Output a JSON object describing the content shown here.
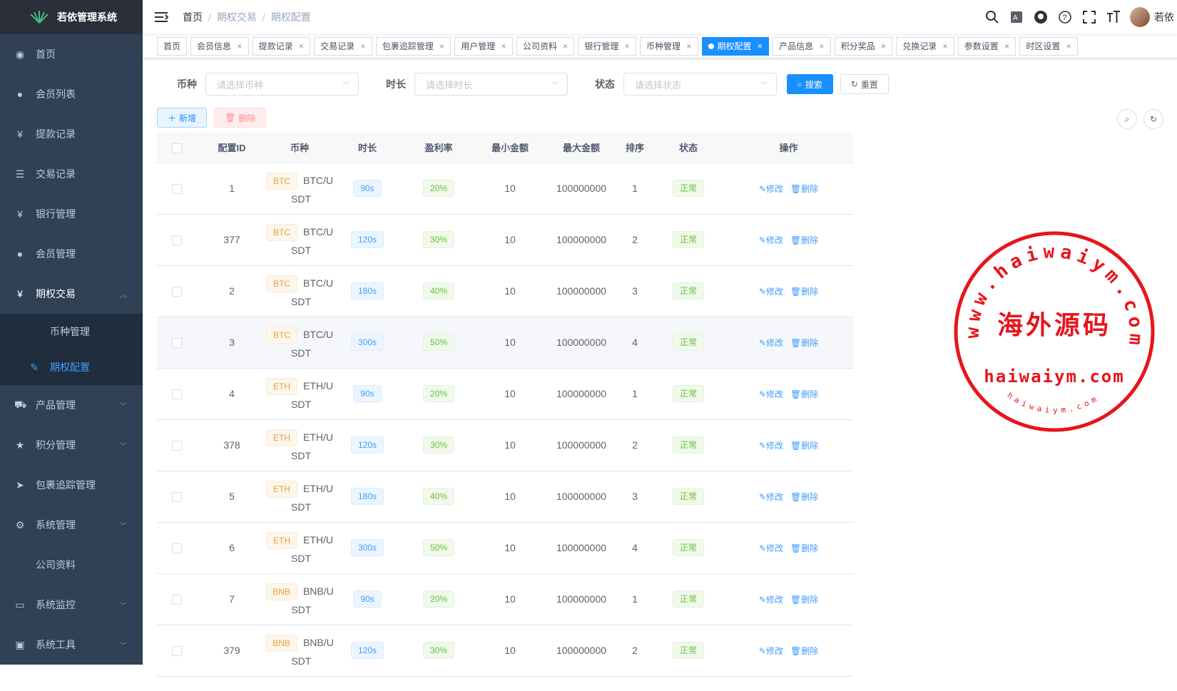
{
  "app": {
    "title": "若依管理系统"
  },
  "sidebar": {
    "items": [
      {
        "label": "首页",
        "icon": "dashboard-icon"
      },
      {
        "label": "会员列表",
        "icon": "user-icon"
      },
      {
        "label": "提款记录",
        "icon": "yen-icon"
      },
      {
        "label": "交易记录",
        "icon": "list-icon"
      },
      {
        "label": "银行管理",
        "icon": "yen-icon"
      },
      {
        "label": "会员管理",
        "icon": "peoples-icon"
      },
      {
        "label": "期权交易",
        "icon": "yen-icon"
      },
      {
        "label": "币种管理"
      },
      {
        "label": "期权配置",
        "icon": "edit-icon"
      },
      {
        "label": "产品管理",
        "icon": "cart-icon"
      },
      {
        "label": "积分管理",
        "icon": "star-icon"
      },
      {
        "label": "包裹追踪管理",
        "icon": "send-icon"
      },
      {
        "label": "系统管理",
        "icon": "gear-icon"
      },
      {
        "label": "公司资料"
      },
      {
        "label": "系统监控",
        "icon": "monitor-icon"
      },
      {
        "label": "系统工具",
        "icon": "tool-icon"
      }
    ]
  },
  "breadcrumb": [
    "首页",
    "期权交易",
    "期权配置"
  ],
  "header": {
    "user": "若依"
  },
  "tags": [
    "首页",
    "会员信息",
    "提款记录",
    "交易记录",
    "包裹追踪管理",
    "用户管理",
    "公司资料",
    "银行管理",
    "币种管理",
    "期权配置",
    "产品信息",
    "积分奖品",
    "兑换记录",
    "参数设置",
    "时区设置"
  ],
  "search": {
    "coin_label": "币种",
    "coin_placeholder": "请选择币种",
    "duration_label": "时长",
    "duration_placeholder": "请选择时长",
    "status_label": "状态",
    "status_placeholder": "请选择状态",
    "search_btn": "搜索",
    "reset_btn": "重置"
  },
  "toolbar": {
    "add": "新增",
    "delete": "删除"
  },
  "table": {
    "headers": [
      "配置ID",
      "币种",
      "时长",
      "盈利率",
      "最小金额",
      "最大金额",
      "排序",
      "状态",
      "操作"
    ],
    "edit_label": "修改",
    "delete_label": "删除",
    "rows": [
      {
        "id": "1",
        "coin": "BTC",
        "pair1": "BTC/U",
        "pair2": "SDT",
        "duration": "90s",
        "rate": "20%",
        "min": "10",
        "max": "100000000",
        "sort": "1",
        "status": "正常"
      },
      {
        "id": "377",
        "coin": "BTC",
        "pair1": "BTC/U",
        "pair2": "SDT",
        "duration": "120s",
        "rate": "30%",
        "min": "10",
        "max": "100000000",
        "sort": "2",
        "status": "正常"
      },
      {
        "id": "2",
        "coin": "BTC",
        "pair1": "BTC/U",
        "pair2": "SDT",
        "duration": "180s",
        "rate": "40%",
        "min": "10",
        "max": "100000000",
        "sort": "3",
        "status": "正常"
      },
      {
        "id": "3",
        "coin": "BTC",
        "pair1": "BTC/U",
        "pair2": "SDT",
        "duration": "300s",
        "rate": "50%",
        "min": "10",
        "max": "100000000",
        "sort": "4",
        "status": "正常"
      },
      {
        "id": "4",
        "coin": "ETH",
        "pair1": "ETH/U",
        "pair2": "SDT",
        "duration": "90s",
        "rate": "20%",
        "min": "10",
        "max": "100000000",
        "sort": "1",
        "status": "正常"
      },
      {
        "id": "378",
        "coin": "ETH",
        "pair1": "ETH/U",
        "pair2": "SDT",
        "duration": "120s",
        "rate": "30%",
        "min": "10",
        "max": "100000000",
        "sort": "2",
        "status": "正常"
      },
      {
        "id": "5",
        "coin": "ETH",
        "pair1": "ETH/U",
        "pair2": "SDT",
        "duration": "180s",
        "rate": "40%",
        "min": "10",
        "max": "100000000",
        "sort": "3",
        "status": "正常"
      },
      {
        "id": "6",
        "coin": "ETH",
        "pair1": "ETH/U",
        "pair2": "SDT",
        "duration": "300s",
        "rate": "50%",
        "min": "10",
        "max": "100000000",
        "sort": "4",
        "status": "正常"
      },
      {
        "id": "7",
        "coin": "BNB",
        "pair1": "BNB/U",
        "pair2": "SDT",
        "duration": "90s",
        "rate": "20%",
        "min": "10",
        "max": "100000000",
        "sort": "1",
        "status": "正常"
      },
      {
        "id": "379",
        "coin": "BNB",
        "pair1": "BNB/U",
        "pair2": "SDT",
        "duration": "120s",
        "rate": "30%",
        "min": "10",
        "max": "100000000",
        "sort": "2",
        "status": "正常"
      }
    ]
  },
  "watermark": {
    "top_arc": "www.haiwaiym.com",
    "center": "海外源码",
    "domain": "haiwaiym.com",
    "bottom_arc": "haiwaiym.com",
    "color": "#e8141b"
  }
}
